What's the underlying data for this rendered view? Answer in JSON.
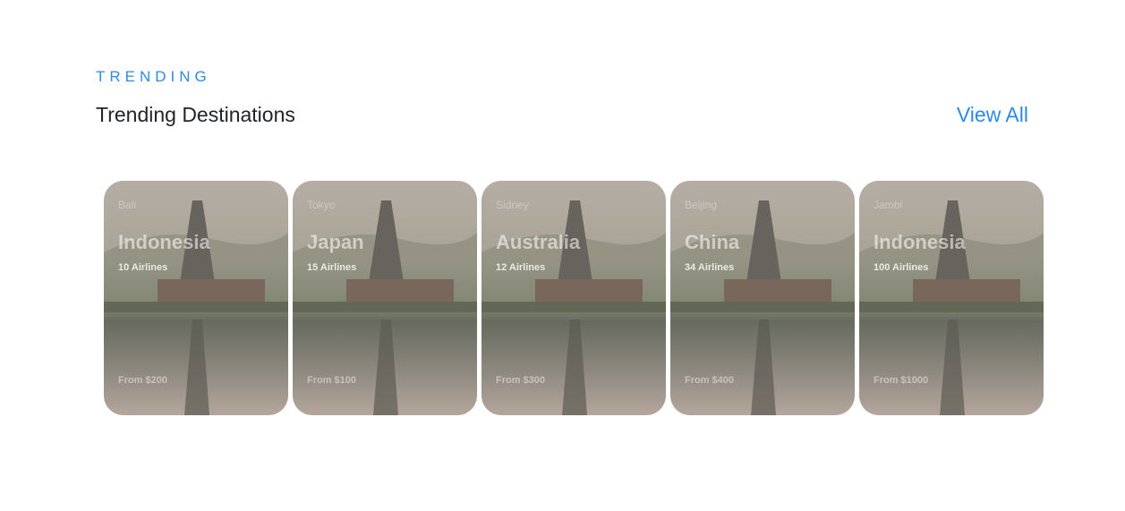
{
  "section": {
    "eyebrow": "TRENDING",
    "title": "Trending Destinations",
    "view_all": "View All"
  },
  "colors": {
    "accent": "#2e8ae8",
    "heading": "#222427"
  },
  "cards": [
    {
      "city": "Bali",
      "country": "Indonesia",
      "airlines": "10 Airlines",
      "price": "From $200"
    },
    {
      "city": "Tokyo",
      "country": "Japan",
      "airlines": "15 Airlines",
      "price": "From $100"
    },
    {
      "city": "Sidney",
      "country": "Australia",
      "airlines": "12 Airlines",
      "price": "From $300"
    },
    {
      "city": "Beijing",
      "country": "China",
      "airlines": "34 Airlines",
      "price": "From $400"
    },
    {
      "city": "Jambi",
      "country": "Indonesia",
      "airlines": "100 Airlines",
      "price": "From $1000"
    }
  ]
}
